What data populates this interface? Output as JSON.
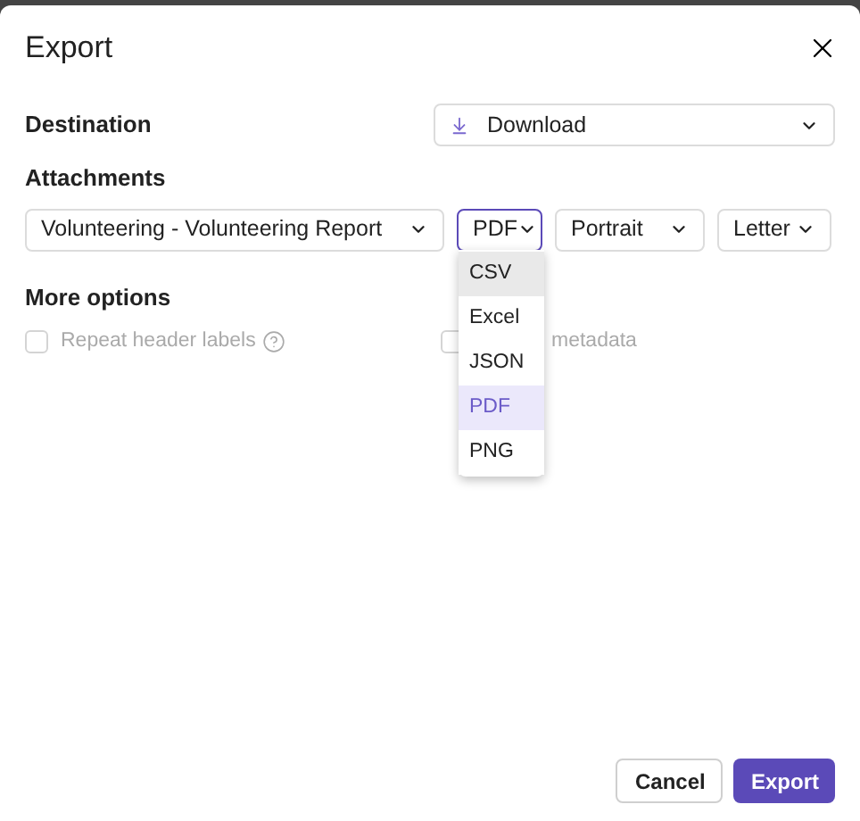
{
  "dialog": {
    "title": "Export"
  },
  "destination": {
    "label": "Destination",
    "value": "Download"
  },
  "attachments": {
    "label": "Attachments",
    "report": "Volunteering - Volunteering Report",
    "format": {
      "value": "PDF",
      "focused": true,
      "expanded": true,
      "options": [
        {
          "label": "CSV",
          "selected": false,
          "highlighted": true
        },
        {
          "label": "Excel",
          "selected": false,
          "highlighted": false
        },
        {
          "label": "JSON",
          "selected": false,
          "highlighted": false
        },
        {
          "label": "PDF",
          "selected": true,
          "highlighted": false
        },
        {
          "label": "PNG",
          "selected": false,
          "highlighted": false
        }
      ]
    },
    "orientation": "Portrait",
    "paper": "Letter"
  },
  "more_options": {
    "label": "More options",
    "options": [
      {
        "label": "Repeat header labels",
        "checked": false,
        "disabled": true,
        "help": true
      },
      {
        "label": "metadata",
        "checked": false,
        "disabled": true,
        "help": false
      }
    ]
  },
  "buttons": [
    {
      "label": "Cancel",
      "kind": "secondary"
    },
    {
      "label": "Export",
      "kind": "primary"
    }
  ]
}
